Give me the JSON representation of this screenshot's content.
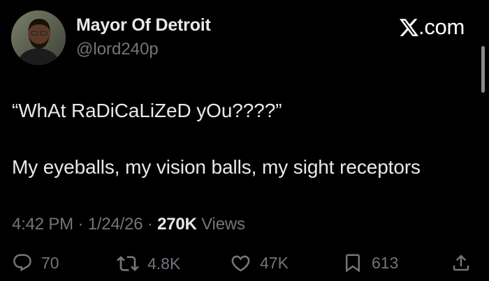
{
  "header": {
    "display_name": "Mayor Of Detroit",
    "handle": "@lord240p",
    "brand": ".com",
    "avatar_icon": "user-avatar-photo"
  },
  "tweet": {
    "lines": [
      "“WhAt RaDiCaLiZeD yOu????”",
      "My eyeballs, my vision balls, my sight receptors"
    ]
  },
  "meta": {
    "time": "4:42 PM",
    "separator": "·",
    "date": "1/24/26",
    "views_count": "270K",
    "views_label": "Views"
  },
  "actions": {
    "replies": "70",
    "reposts": "4.8K",
    "likes": "47K",
    "bookmarks": "613"
  },
  "colors": {
    "background": "#000000",
    "primary_text": "#e7e9ea",
    "secondary_text": "#71767b"
  }
}
